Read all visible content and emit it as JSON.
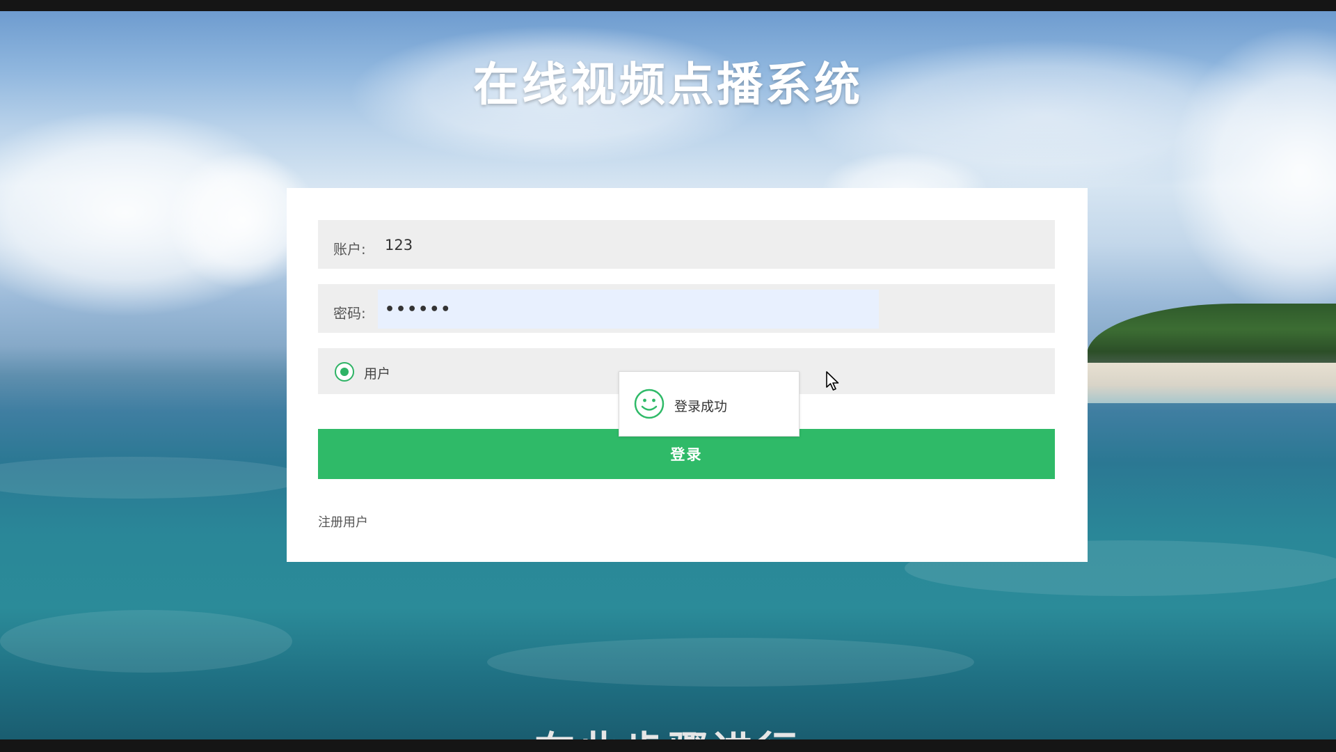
{
  "app": {
    "title": "在线视频点播系统"
  },
  "form": {
    "account_label": "账户:",
    "account_value": "123",
    "password_label": "密码:",
    "password_value": "••••••",
    "role_option": "用户",
    "login_button": "登录",
    "register_link": "注册用户"
  },
  "toast": {
    "message": "登录成功",
    "icon": "smile-icon"
  },
  "subtitle": {
    "text": "在此步骤进行"
  },
  "colors": {
    "accent": "#2fba68",
    "card": "#ffffff",
    "field": "#eeeeee",
    "autofill": "#e8f0fe"
  }
}
